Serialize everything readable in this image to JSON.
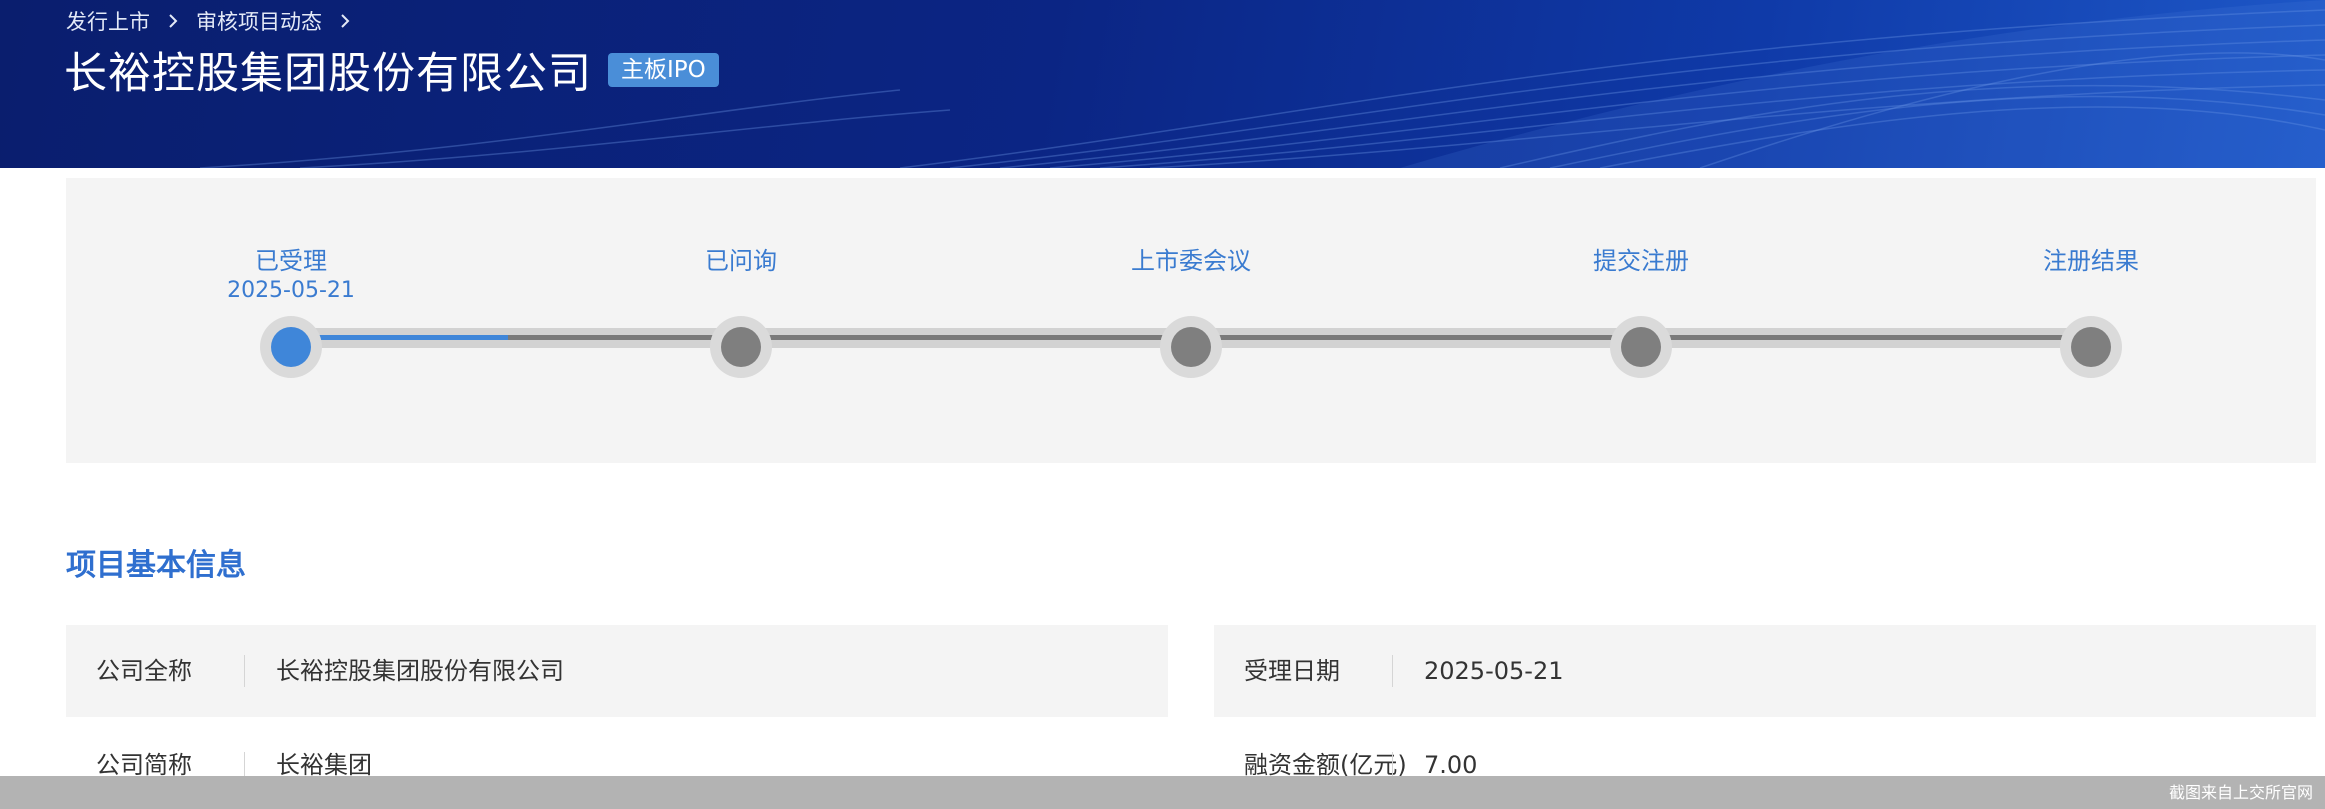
{
  "breadcrumb": [
    "发行上市",
    "审核项目动态"
  ],
  "header": {
    "company_title": "长裕控股集团股份有限公司",
    "board_badge": "主板IPO"
  },
  "progress": {
    "steps": [
      {
        "label": "已受理",
        "date": "2025-05-21",
        "active": true
      },
      {
        "label": "已问询",
        "date": ""
      },
      {
        "label": "上市委会议",
        "date": ""
      },
      {
        "label": "提交注册",
        "date": ""
      },
      {
        "label": "注册结果",
        "date": ""
      }
    ]
  },
  "section": {
    "title": "项目基本信息"
  },
  "info": {
    "full_name_label": "公司全称",
    "full_name_value": "长裕控股集团股份有限公司",
    "accept_date_label": "受理日期",
    "accept_date_value": "2025-05-21",
    "short_name_label": "公司简称",
    "short_name_value": "长裕集团",
    "financing_label": "融资金额(亿元)",
    "financing_value": "7.00"
  },
  "footer": {
    "note": "截图来自上交所官网"
  },
  "colors": {
    "header_bg": "#0b2584",
    "accent_blue": "#3f86d9",
    "section_title": "#2f6fcf",
    "panel_bg": "#f4f4f4"
  }
}
